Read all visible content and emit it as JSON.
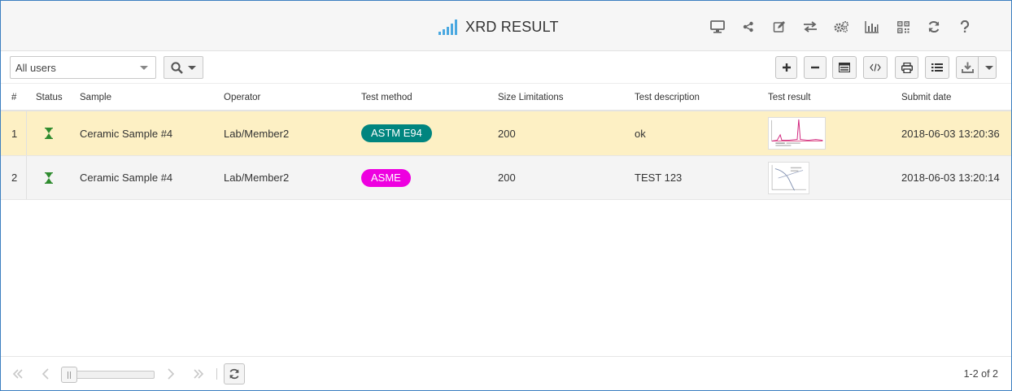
{
  "header": {
    "title": "XRD RESULT",
    "logo_icon": "signal-bars-icon",
    "tools": [
      {
        "name": "monitor-icon"
      },
      {
        "name": "share-icon"
      },
      {
        "name": "edit-icon"
      },
      {
        "name": "transfer-icon"
      },
      {
        "name": "gears-icon"
      },
      {
        "name": "bar-chart-icon"
      },
      {
        "name": "qr-code-icon"
      },
      {
        "name": "refresh-icon"
      },
      {
        "name": "help-icon"
      }
    ]
  },
  "toolbar": {
    "user_filter": "All users",
    "search_icon": "search-icon",
    "buttons": [
      "add-icon",
      "remove-icon",
      "columns-icon",
      "code-icon",
      "print-icon",
      "list-icon",
      "download-icon"
    ]
  },
  "table": {
    "columns": [
      "#",
      "Status",
      "Sample",
      "Operator",
      "Test method",
      "Size Limitations",
      "Test description",
      "Test result",
      "Submit date"
    ],
    "rows": [
      {
        "num": "1",
        "status_icon": "hourglass-icon",
        "sample": "Ceramic Sample #4",
        "operator": "Lab/Member2",
        "method": "ASTM E94",
        "method_color": "#00857f",
        "size": "200",
        "description": "ok",
        "result": "xrd-plot-thumbnail",
        "date": "2018-06-03 13:20:36"
      },
      {
        "num": "2",
        "status_icon": "hourglass-icon",
        "sample": "Ceramic Sample #4",
        "operator": "Lab/Member2",
        "method": "ASME",
        "method_color": "#ee00e0",
        "size": "200",
        "description": "TEST 123",
        "result": "curve-plot-thumbnail",
        "date": "2018-06-03 13:20:14"
      }
    ]
  },
  "colors": {
    "accent": "#4aa8e0",
    "selected_row": "#fdf0c4",
    "frame_border": "#3c7fc0",
    "status_green": "#2e8b2e"
  },
  "footer": {
    "page_info": "1-2 of 2"
  }
}
